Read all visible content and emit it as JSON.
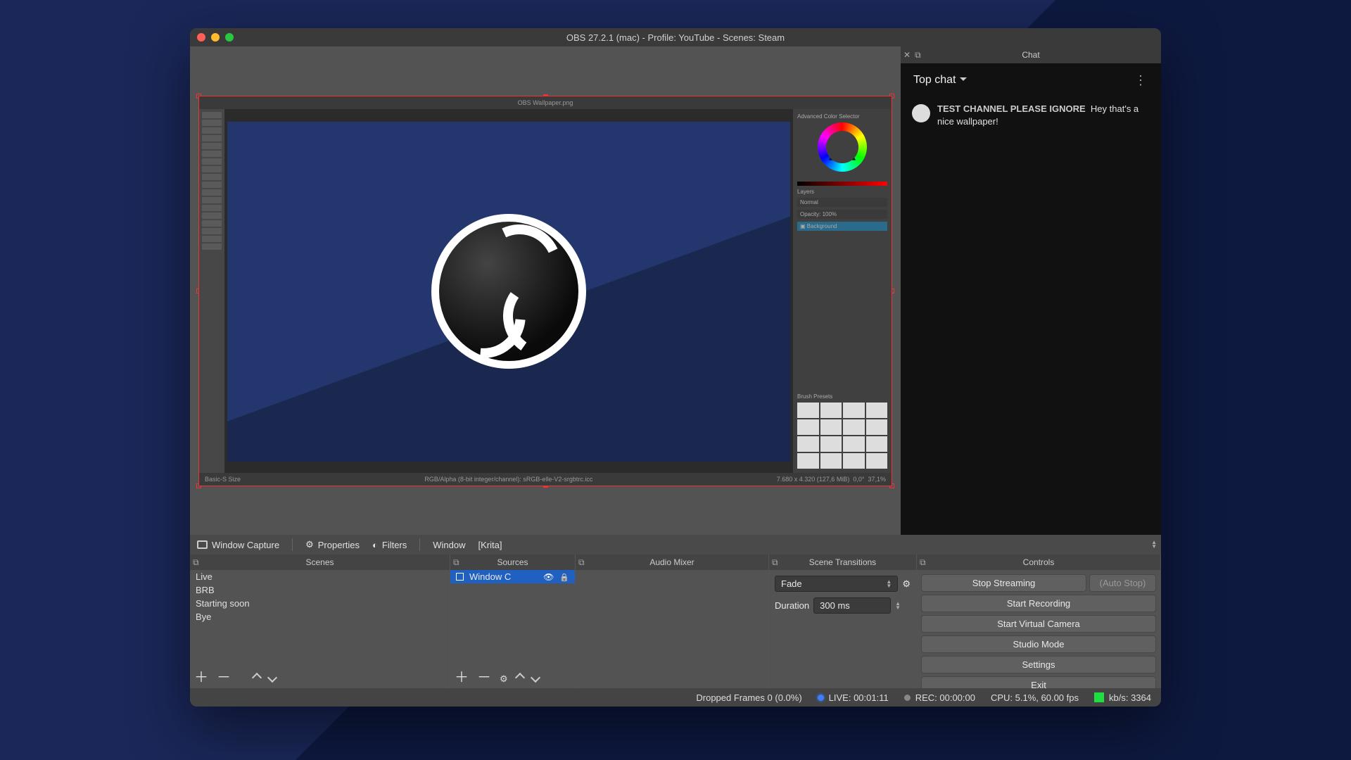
{
  "window": {
    "title": "OBS 27.2.1 (mac) - Profile: YouTube - Scenes: Steam"
  },
  "source_toolbar": {
    "source_type": "Window Capture",
    "properties": "Properties",
    "filters": "Filters",
    "field_label": "Window",
    "field_value": "[Krita]"
  },
  "docks": {
    "scenes": {
      "title": "Scenes",
      "items": [
        "Live",
        "BRB",
        "Starting soon",
        "Bye"
      ]
    },
    "sources": {
      "title": "Sources",
      "items": [
        {
          "name": "Window C",
          "visible": true,
          "locked": false
        }
      ]
    },
    "mixer": {
      "title": "Audio Mixer"
    },
    "transitions": {
      "title": "Scene Transitions",
      "selected": "Fade",
      "duration_label": "Duration",
      "duration": "300 ms"
    },
    "controls": {
      "title": "Controls",
      "stop_stream": "Stop Streaming",
      "auto_stop": "(Auto Stop)",
      "start_rec": "Start Recording",
      "start_vcam": "Start Virtual Camera",
      "studio": "Studio Mode",
      "settings": "Settings",
      "exit": "Exit"
    }
  },
  "chat": {
    "title": "Chat",
    "mode": "Top chat",
    "messages": [
      {
        "user": "TEST CHANNEL PLEASE IGNORE",
        "text": "Hey that's a nice wallpaper!"
      }
    ]
  },
  "preview": {
    "app_title": "OBS Wallpaper.png",
    "footer_left": "Basic-S Size",
    "footer_mid": "RGB/Alpha (8-bit integer/channel): sRGB-elle-V2-srgbtrc.icc",
    "footer_right1": "7.680 x 4.320 (127,6 MiB)",
    "footer_right2": "0,0°",
    "footer_right3": "37,1%"
  },
  "status": {
    "dropped": "Dropped Frames 0 (0.0%)",
    "live": "LIVE: 00:01:11",
    "rec": "REC: 00:00:00",
    "cpu": "CPU: 5.1%, 60.00 fps",
    "kbps": "kb/s: 3364"
  }
}
